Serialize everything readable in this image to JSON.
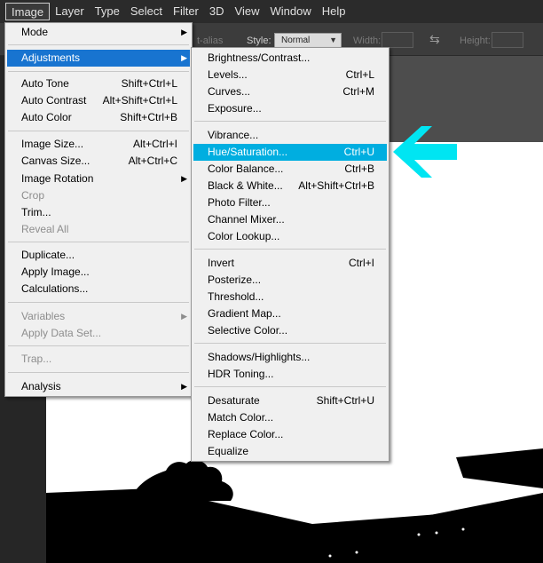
{
  "menubar": {
    "items": [
      "Image",
      "Layer",
      "Type",
      "Select",
      "Filter",
      "3D",
      "View",
      "Window",
      "Help"
    ]
  },
  "options_bar": {
    "antialias_label": "t-alias",
    "style_label": "Style:",
    "style_value": "Normal",
    "width_label": "Width:",
    "height_label": "Height:"
  },
  "image_menu": {
    "items": [
      {
        "label": "Mode",
        "shortcut": "",
        "submenu": true
      },
      {
        "label": "Adjustments",
        "shortcut": "",
        "submenu": true,
        "selected": true
      },
      {
        "label": "Auto Tone",
        "shortcut": "Shift+Ctrl+L"
      },
      {
        "label": "Auto Contrast",
        "shortcut": "Alt+Shift+Ctrl+L"
      },
      {
        "label": "Auto Color",
        "shortcut": "Shift+Ctrl+B"
      },
      {
        "label": "Image Size...",
        "shortcut": "Alt+Ctrl+I"
      },
      {
        "label": "Canvas Size...",
        "shortcut": "Alt+Ctrl+C"
      },
      {
        "label": "Image Rotation",
        "shortcut": "",
        "submenu": true
      },
      {
        "label": "Crop",
        "shortcut": "",
        "disabled": true
      },
      {
        "label": "Trim...",
        "shortcut": ""
      },
      {
        "label": "Reveal All",
        "shortcut": "",
        "disabled": true
      },
      {
        "label": "Duplicate...",
        "shortcut": ""
      },
      {
        "label": "Apply Image...",
        "shortcut": ""
      },
      {
        "label": "Calculations...",
        "shortcut": ""
      },
      {
        "label": "Variables",
        "shortcut": "",
        "submenu": true,
        "disabled": true
      },
      {
        "label": "Apply Data Set...",
        "shortcut": "",
        "disabled": true
      },
      {
        "label": "Trap...",
        "shortcut": "",
        "disabled": true
      },
      {
        "label": "Analysis",
        "shortcut": "",
        "submenu": true
      }
    ]
  },
  "adjustments_menu": {
    "items": [
      {
        "label": "Brightness/Contrast...",
        "shortcut": ""
      },
      {
        "label": "Levels...",
        "shortcut": "Ctrl+L"
      },
      {
        "label": "Curves...",
        "shortcut": "Ctrl+M"
      },
      {
        "label": "Exposure...",
        "shortcut": ""
      },
      {
        "label": "Vibrance...",
        "shortcut": ""
      },
      {
        "label": "Hue/Saturation...",
        "shortcut": "Ctrl+U",
        "selected": true
      },
      {
        "label": "Color Balance...",
        "shortcut": "Ctrl+B"
      },
      {
        "label": "Black & White...",
        "shortcut": "Alt+Shift+Ctrl+B"
      },
      {
        "label": "Photo Filter...",
        "shortcut": ""
      },
      {
        "label": "Channel Mixer...",
        "shortcut": ""
      },
      {
        "label": "Color Lookup...",
        "shortcut": ""
      },
      {
        "label": "Invert",
        "shortcut": "Ctrl+I"
      },
      {
        "label": "Posterize...",
        "shortcut": ""
      },
      {
        "label": "Threshold...",
        "shortcut": ""
      },
      {
        "label": "Gradient Map...",
        "shortcut": ""
      },
      {
        "label": "Selective Color...",
        "shortcut": ""
      },
      {
        "label": "Shadows/Highlights...",
        "shortcut": ""
      },
      {
        "label": "HDR Toning...",
        "shortcut": ""
      },
      {
        "label": "Desaturate",
        "shortcut": "Shift+Ctrl+U"
      },
      {
        "label": "Match Color...",
        "shortcut": ""
      },
      {
        "label": "Replace Color...",
        "shortcut": ""
      },
      {
        "label": "Equalize",
        "shortcut": ""
      }
    ]
  },
  "colors": {
    "menu_highlight": "#1874d0",
    "hue_highlight": "#00aee0",
    "pointer_arrow": "#00e5f2"
  },
  "icons": {
    "submenu_arrow": "triangle-right-icon",
    "annotation": "pointer-arrow-icon"
  }
}
